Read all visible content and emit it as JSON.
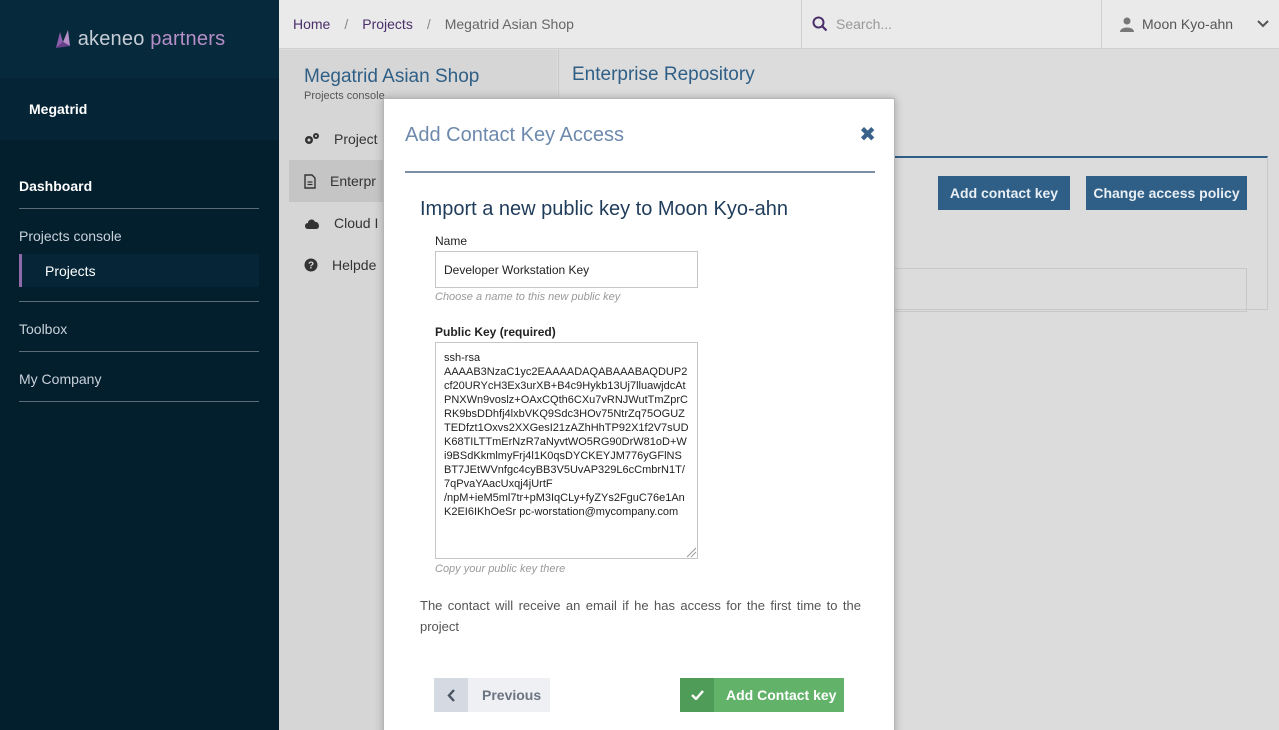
{
  "sidebar": {
    "logo_primary": "akeneo",
    "logo_secondary": "partners",
    "organization": "Megatrid",
    "sections": [
      {
        "title": "Dashboard"
      },
      {
        "title": "Projects console",
        "sub": "Projects"
      },
      {
        "title": "Toolbox"
      },
      {
        "title": "My Company"
      }
    ]
  },
  "topbar": {
    "breadcrumb": [
      "Home",
      "Projects",
      "Megatrid Asian Shop"
    ],
    "separator": "/",
    "search_placeholder": "Search...",
    "user_name": "Moon Kyo-ahn"
  },
  "project": {
    "title": "Megatrid Asian Shop",
    "subtitle": "Projects console",
    "menu": [
      "Project",
      "Enterpr",
      "Cloud I",
      "Helpde"
    ]
  },
  "content": {
    "title": "Enterprise Repository",
    "add_contact_key_label": "Add contact key",
    "change_access_policy_label": "Change access policy"
  },
  "modal": {
    "title": "Add Contact Key Access",
    "heading": "Import a new public key to Moon Kyo-ahn",
    "name_label": "Name",
    "name_value": "Developer Workstation Key",
    "name_hint": "Choose a name to this new public key",
    "key_label": "Public Key (required)",
    "key_value": "ssh-rsa\nAAAAB3NzaC1yc2EAAAADAQABAAABAQDUP2cf20URYcH3Ex3urXB+B4c9Hykb13Uj7lluawjdcAtPNXWn9voslz+OAxCQth6CXu7vRNJWutTmZprCRK9bsDDhfj4lxbVKQ9Sdc3HOv75NtrZq75OGUZTEDfzt1Oxvs2XXGesI21zAZhHhTP92X1f2V7sUDK68TILTTmErNzR7aNyvtWO5RG90DrW81oD+Wi9BSdKkmlmyFrj4l1K0qsDYCKEYJM776yGFlNSBT7JEtWVnfgc4cyBB3V5UvAP329L6cCmbrN1T/7qPvaYAacUxqj4jUrtF\n/npM+ieM5ml7tr+pM3IqCLy+fyZYs2FguC76e1AnK2EI6IKhOeSr pc-worstation@mycompany.com",
    "key_hint": "Copy your public key there",
    "notice": "The contact will receive an email if he has access for the first time to the project",
    "previous_label": "Previous",
    "submit_label": "Add Contact key"
  }
}
